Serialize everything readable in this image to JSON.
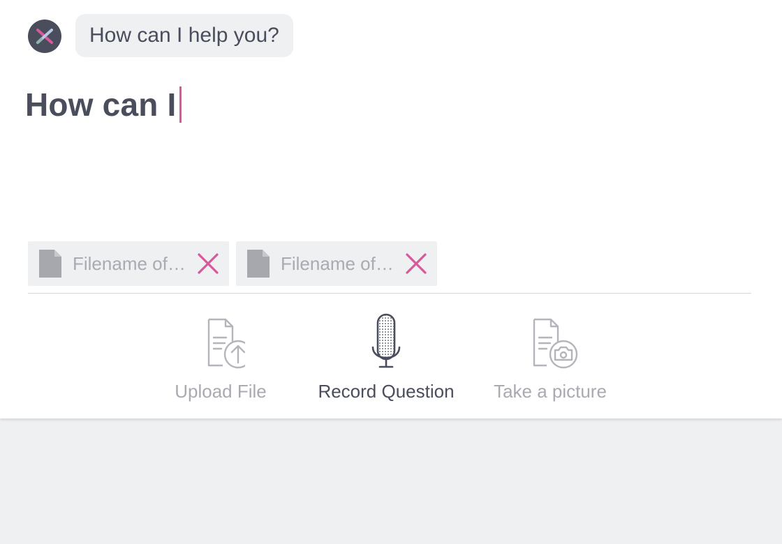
{
  "assistant": {
    "avatar_icon": "assistant-logo-icon",
    "greeting": "How can I help you?"
  },
  "composer": {
    "text": "How can I"
  },
  "attachments": [
    {
      "icon": "file-icon",
      "name": "Filename of attachment",
      "remove_icon": "close-icon"
    },
    {
      "icon": "file-icon",
      "name": "Filename of attachment",
      "remove_icon": "close-icon"
    }
  ],
  "actions": {
    "upload": {
      "label": "Upload File",
      "icon": "upload-file-icon",
      "enabled": false
    },
    "record": {
      "label": "Record Question",
      "icon": "microphone-icon",
      "enabled": true
    },
    "picture": {
      "label": "Take a picture",
      "icon": "camera-document-icon",
      "enabled": false
    }
  },
  "colors": {
    "accent": "#d9579b",
    "text": "#4a4d5c",
    "muted": "#a9aab2",
    "surface": "#eff0f2"
  }
}
